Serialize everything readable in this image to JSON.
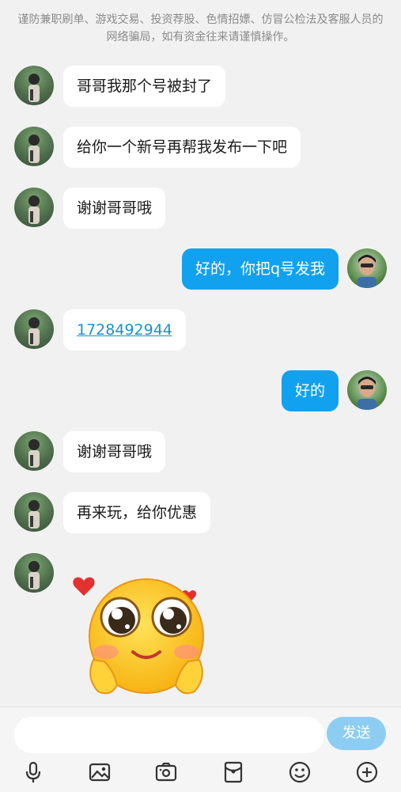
{
  "notice": "谨防兼职刷单、游戏交易、投资荐股、色情招嫖、仿冒公检法及客服人员的网络骗局，如有资金往来请谨慎操作。",
  "messages": [
    {
      "side": "in",
      "text": "哥哥我那个号被封了"
    },
    {
      "side": "in",
      "text": "给你一个新号再帮我发布一下吧"
    },
    {
      "side": "in",
      "text": "谢谢哥哥哦"
    },
    {
      "side": "out",
      "text": "好的，你把q号发我"
    },
    {
      "side": "in",
      "text": "1728492944",
      "link": true
    },
    {
      "side": "out",
      "text": "好的"
    },
    {
      "side": "in",
      "text": "谢谢哥哥哦"
    },
    {
      "side": "in",
      "text": "再来玩，给你优惠"
    },
    {
      "side": "in",
      "sticker": "blushing-pleading-emoji-with-hearts"
    }
  ],
  "composer": {
    "placeholder": "",
    "send_label": "发送"
  },
  "toolbar": [
    "microphone-icon",
    "image-icon",
    "camera-icon",
    "red-packet-icon",
    "emoji-icon",
    "plus-icon"
  ],
  "colors": {
    "outgoing_bubble": "#12a1ef",
    "incoming_bubble": "#ffffff",
    "send_button": "#8ecdf2",
    "link": "#1593cf"
  }
}
